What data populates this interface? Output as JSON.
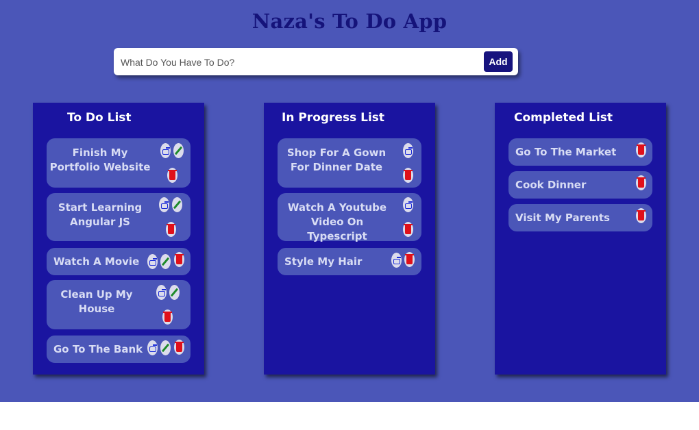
{
  "app": {
    "title": "Naza's To Do App",
    "input_placeholder": "What Do You Have To Do?",
    "input_value": "",
    "add_label": "Add",
    "colors": {
      "background": "#4b56b8",
      "column": "#1a14a0",
      "title": "#15137a",
      "button": "#17137e",
      "delete": "#e0101a",
      "edit": "#1e8a2a",
      "move": "#1a2ad8"
    }
  },
  "todo": {
    "title": "To Do List",
    "items": [
      {
        "label": "Finish My Portfolio Website",
        "actions": [
          "move-icon",
          "edit-icon",
          "delete-icon"
        ]
      },
      {
        "label": "Start Learning Angular JS",
        "actions": [
          "move-icon",
          "edit-icon",
          "delete-icon"
        ]
      },
      {
        "label": "Watch A Movie",
        "actions": [
          "move-icon",
          "edit-icon",
          "delete-icon"
        ]
      },
      {
        "label": "Clean Up My House",
        "actions": [
          "move-icon",
          "edit-icon",
          "delete-icon"
        ]
      },
      {
        "label": "Go To The Bank",
        "actions": [
          "move-icon",
          "edit-icon",
          "delete-icon"
        ]
      }
    ]
  },
  "progress": {
    "title": "In Progress List",
    "items": [
      {
        "label": "Shop For A Gown For Dinner Date",
        "actions": [
          "move-icon",
          "delete-icon"
        ]
      },
      {
        "label": "Watch A Youtube Video On Typescript",
        "actions": [
          "move-icon",
          "delete-icon"
        ]
      },
      {
        "label": "Style My Hair",
        "actions": [
          "move-icon",
          "delete-icon"
        ]
      }
    ]
  },
  "completed": {
    "title": "Completed List",
    "items": [
      {
        "label": "Go To The Market",
        "actions": [
          "delete-icon"
        ]
      },
      {
        "label": "Cook Dinner",
        "actions": [
          "delete-icon"
        ]
      },
      {
        "label": "Visit My Parents",
        "actions": [
          "delete-icon"
        ]
      }
    ]
  }
}
